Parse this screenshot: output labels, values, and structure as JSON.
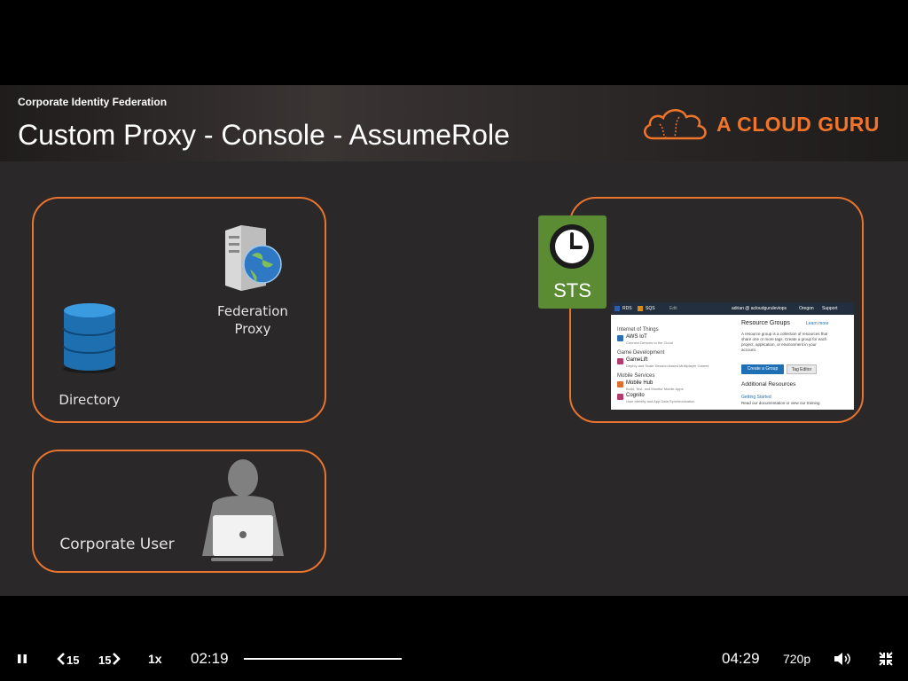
{
  "slide": {
    "subtitle": "Corporate Identity Federation",
    "title": "Custom Proxy - Console - AssumeRole",
    "logo_text": "A CLOUD GURU",
    "labels": {
      "federation_proxy_line1": "Federation",
      "federation_proxy_line2": "Proxy",
      "directory": "Directory",
      "corporate_user": "Corporate User",
      "sts": "STS"
    },
    "colors": {
      "accent": "#e8742e",
      "sts_green": "#5b8c34",
      "slide_bg": "#2a2829"
    }
  },
  "console": {
    "nav": {
      "rds": "RDS",
      "sqs": "SQS",
      "edit": "Edit",
      "user": "adrian @ acloudguruleviops",
      "region": "Oregon",
      "support": "Support"
    },
    "sections": [
      {
        "title": "Internet of Things",
        "item": "AWS IoT",
        "desc": "Connect Devices to the Cloud"
      },
      {
        "title": "Game Development",
        "item": "GameLift",
        "desc": "Deploy and Scale Session-based Multiplayer Games"
      },
      {
        "title": "Mobile Services",
        "item": "Mobile Hub",
        "desc": "Build, Test, and Monitor Mobile Apps"
      },
      {
        "title": "",
        "item": "Cognito",
        "desc": "User Identity and App Data Synchronization"
      }
    ],
    "resource_groups": "Resource Groups",
    "learn_more": "Learn more",
    "rg_description": "A resource group is a collection of resources that share one or more tags. Create a group for each project, application, or environment in your account.",
    "create_group": "Create a Group",
    "tag_editor": "Tag Editor",
    "additional_resources": "Additional Resources",
    "getting_started": "Getting Started",
    "read_docs": "Read our documentation or view our training"
  },
  "player": {
    "skip_back": "15",
    "skip_forward": "15",
    "speed": "1x",
    "current_time": "02:19",
    "duration": "04:29",
    "quality": "720p",
    "progress": 0.517
  }
}
